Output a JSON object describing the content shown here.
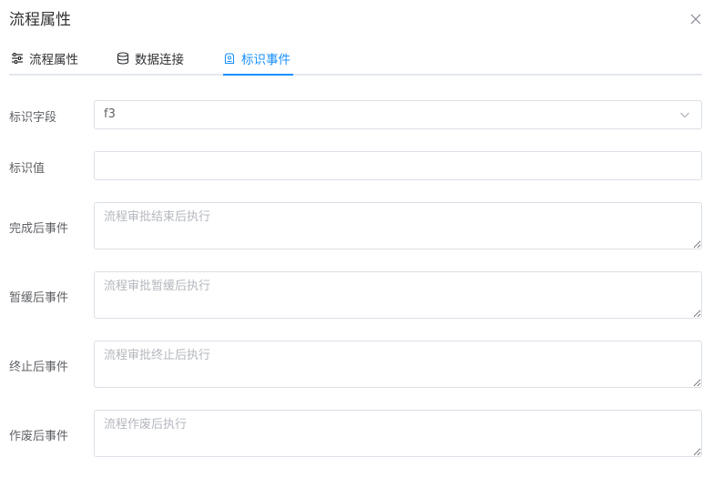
{
  "dialog": {
    "title": "流程属性"
  },
  "tabs": [
    {
      "label": "流程属性",
      "icon": "sliders-icon"
    },
    {
      "label": "数据连接",
      "icon": "database-icon"
    },
    {
      "label": "标识事件",
      "icon": "tag-icon",
      "active": true
    }
  ],
  "form": {
    "flag_field": {
      "label": "标识字段",
      "value": "f3"
    },
    "flag_value": {
      "label": "标识值",
      "value": "",
      "placeholder": ""
    },
    "after_complete": {
      "label": "完成后事件",
      "placeholder": "流程审批结束后执行"
    },
    "after_suspend": {
      "label": "暂缓后事件",
      "placeholder": "流程审批暂缓后执行"
    },
    "after_terminate": {
      "label": "终止后事件",
      "placeholder": "流程审批终止后执行"
    },
    "after_void": {
      "label": "作废后事件",
      "placeholder": "流程作废后执行"
    }
  },
  "colors": {
    "accent": "#1890ff",
    "border": "#dcdfe6",
    "text": "#303133",
    "label": "#606266"
  }
}
